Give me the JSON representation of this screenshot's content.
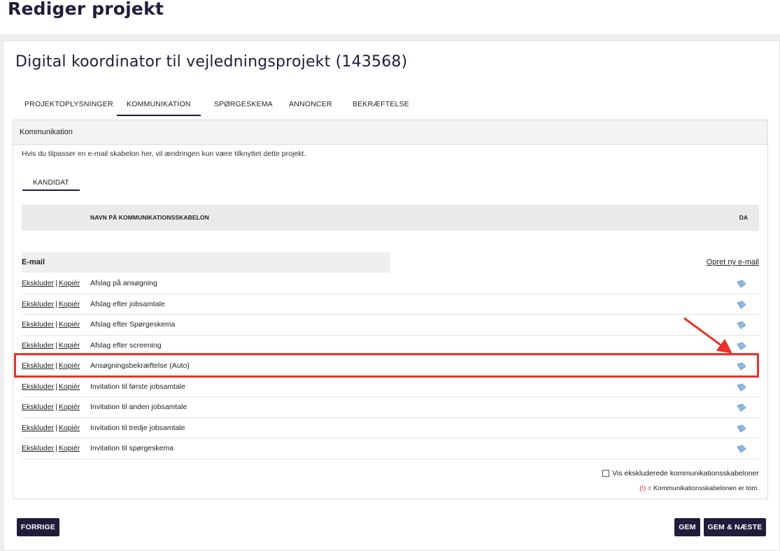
{
  "page": {
    "heading": "Rediger projekt"
  },
  "project": {
    "title": "Digital koordinator til vejledningsprojekt (143568)"
  },
  "tabs": [
    {
      "label": "PROJEKTOPLYSNINGER",
      "active": false
    },
    {
      "label": "KOMMUNIKATION",
      "active": true
    },
    {
      "label": "SPØRGESKEMA",
      "active": false
    },
    {
      "label": "ANNONCER",
      "active": false
    },
    {
      "label": "BEKRÆFTELSE",
      "active": false
    }
  ],
  "panel": {
    "header": "Kommunikation",
    "info": "Hvis du tilpasser en e-mail skabelon her, vil ændringen kun være tilknyttet dette projekt.",
    "subtab": "KANDIDAT"
  },
  "table": {
    "col_name": "NAVN PÅ KOMMUNIKATIONSSKABELON",
    "col_da": "DA",
    "group_label": "E-mail",
    "create_link": "Opret ny e-mail",
    "exclude_label": "Ekskluder",
    "separator": "|",
    "copy_label": "Kopiér",
    "rows": [
      {
        "name": "Afslag på ansøgning",
        "icon": "document-icon"
      },
      {
        "name": "Afslag efter jobsamtale",
        "icon": "document-icon"
      },
      {
        "name": "Afslag efter Spørgeskema",
        "icon": "document-icon"
      },
      {
        "name": "Afslag efter screening",
        "icon": "document-icon"
      },
      {
        "name": "Ansøgningsbekræftelse (Auto)",
        "icon": "document-icon",
        "highlighted": true
      },
      {
        "name": "Invitation til første jobsamtale",
        "icon": "document-icon"
      },
      {
        "name": "Invitation til anden jobsamtale",
        "icon": "document-icon"
      },
      {
        "name": "Invitation til tredje jobsamtale",
        "icon": "document-icon"
      },
      {
        "name": "Invitation til spørgeskema",
        "icon": "document-icon"
      }
    ]
  },
  "footer": {
    "show_excluded_label": "Vis ekskluderede kommunikationsskabeloner",
    "show_excluded_checked": false,
    "legend_mark": "(!)",
    "legend_text": " = Kommunikationsskabelonen er tom."
  },
  "buttons": {
    "previous": "FORRIGE",
    "save": "GEM",
    "save_next": "GEM & NÆSTE"
  },
  "colors": {
    "accent": "#1f1d3a",
    "highlight": "#e8322a",
    "icon": "#7fb3dd"
  }
}
